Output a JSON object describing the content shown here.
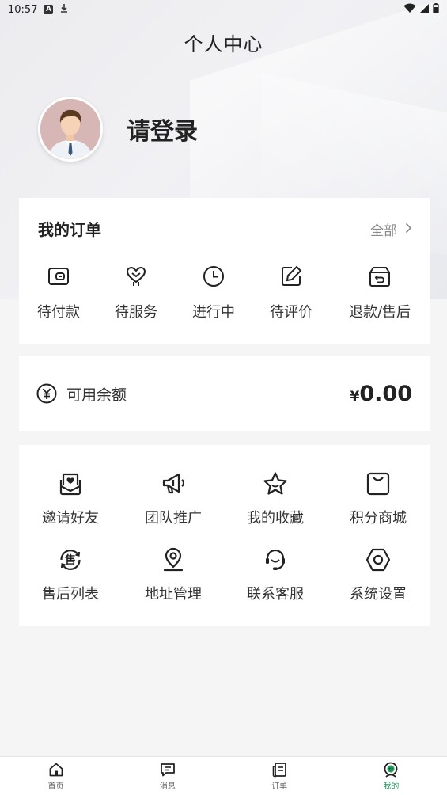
{
  "status_bar": {
    "time": "10:57",
    "left_icons": [
      "a-icon",
      "download-icon"
    ],
    "right_icons": [
      "wifi-icon",
      "signal-icon",
      "battery-icon"
    ]
  },
  "header": {
    "title": "个人中心"
  },
  "profile": {
    "login_prompt": "请登录",
    "avatar_icon": "avatar-icon"
  },
  "orders": {
    "title": "我的订单",
    "all_label": "全部",
    "items": [
      {
        "label": "待付款",
        "icon": "wallet-icon"
      },
      {
        "label": "待服务",
        "icon": "heart-hand-icon"
      },
      {
        "label": "进行中",
        "icon": "clock-icon"
      },
      {
        "label": "待评价",
        "icon": "edit-icon"
      },
      {
        "label": "退款/售后",
        "icon": "refund-box-icon"
      }
    ]
  },
  "balance": {
    "label": "可用余额",
    "currency": "¥",
    "amount": "0.00",
    "icon": "yen-circle-icon"
  },
  "tools": {
    "items": [
      {
        "label": "邀请好友",
        "icon": "invite-envelope-icon"
      },
      {
        "label": "团队推广",
        "icon": "megaphone-icon"
      },
      {
        "label": "我的收藏",
        "icon": "star-icon"
      },
      {
        "label": "积分商城",
        "icon": "shopping-bag-icon"
      },
      {
        "label": "售后列表",
        "icon": "after-sales-icon",
        "glyph": "售"
      },
      {
        "label": "地址管理",
        "icon": "location-pin-icon"
      },
      {
        "label": "联系客服",
        "icon": "headset-icon"
      },
      {
        "label": "系统设置",
        "icon": "hexagon-settings-icon"
      }
    ]
  },
  "tabbar": {
    "active_color": "#1f9a5a",
    "items": [
      {
        "label": "首页",
        "icon": "home-icon",
        "active": false
      },
      {
        "label": "消息",
        "icon": "message-icon",
        "active": false
      },
      {
        "label": "订单",
        "icon": "order-icon",
        "active": false
      },
      {
        "label": "我的",
        "icon": "profile-icon",
        "active": true
      }
    ]
  }
}
